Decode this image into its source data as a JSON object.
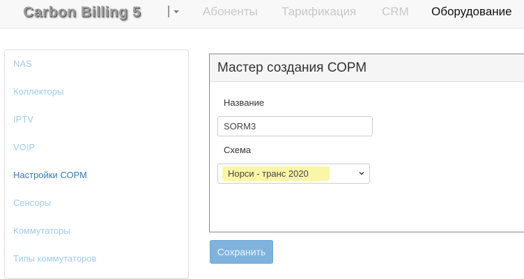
{
  "navbar": {
    "brand": "Carbon Billing 5",
    "menu": [
      "Абоненты",
      "Тарификация",
      "CRM",
      "Оборудование"
    ],
    "active": "Оборудование"
  },
  "sidebar": {
    "items": [
      "NAS",
      "Коллекторы",
      "IPTV",
      "VOIP",
      "Настройки СОРМ",
      "Сенсоры",
      "Коммутаторы",
      "Типы коммутаторов"
    ],
    "active": "Настройки СОРМ"
  },
  "panel": {
    "title": "Мастер создания СОРМ",
    "name_label": "Название",
    "name_value": "SORM3",
    "scheme_label": "Схема",
    "scheme_value": "Норси - транс 2020"
  },
  "actions": {
    "save_label": "Сохранить"
  },
  "colors": {
    "link": "#9ecbec",
    "link_active": "#337ab7",
    "button": "#7fb3dd",
    "highlight": "#fbf5a8"
  }
}
